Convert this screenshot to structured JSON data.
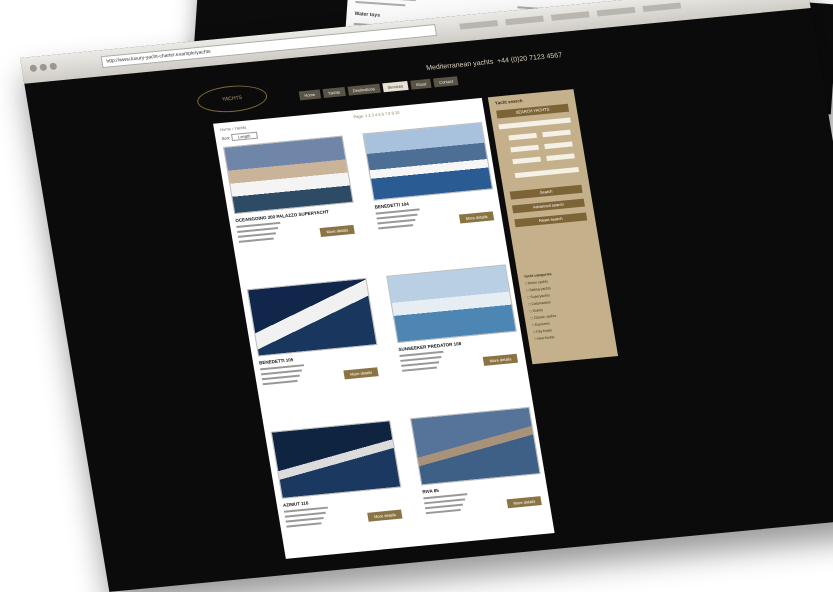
{
  "browser": {
    "url": "http://www.luxury-yacht-charter.example/yachts"
  },
  "site": {
    "logo": "YACHTS",
    "tagline": "Mediterranean yachts",
    "phone": "+44 (0)20 7123 4567",
    "nav": [
      "Home",
      "Yachts",
      "Destinations",
      "Services",
      "About",
      "Contact"
    ],
    "active_nav": 3
  },
  "listing": {
    "breadcrumb": "Home › Yachts",
    "pages_label": "Page: 1 2 3 4 5 6 7 8 9 10",
    "sort_label": "Sort:",
    "sort_value": "Length",
    "more_label": "More details"
  },
  "yachts": [
    {
      "name": "OCEANGOING 200 PALAZZO SUPERYACHT",
      "img": "harbor-yacht"
    },
    {
      "name": "BENEDETTI 104",
      "img": "sea-yacht"
    },
    {
      "name": "BENEDETTI 105",
      "img": "speed-yacht"
    },
    {
      "name": "SUNSEEKER PREDATOR 108",
      "img": "anchored-yacht"
    },
    {
      "name": "AZIMUT 116",
      "img": "speed-yacht-2"
    },
    {
      "name": "RIVA 85",
      "img": "speedboat"
    }
  ],
  "sidebar": {
    "title": "Yacht search",
    "search_label": "SEARCH YACHTS",
    "buttons": [
      "Search",
      "Advanced search",
      "Reset search"
    ],
    "list_title": "Yacht categories",
    "list": [
      "Motor yachts",
      "Sailing yachts",
      "Superyachts",
      "Catamarans",
      "Gulets",
      "Classic yachts",
      "Explorers",
      "Day boats",
      "New builds"
    ]
  },
  "colors": {
    "accent": "#8b7444",
    "sidebar": "#c4b18b",
    "page_bg": "#0b0b0b"
  }
}
